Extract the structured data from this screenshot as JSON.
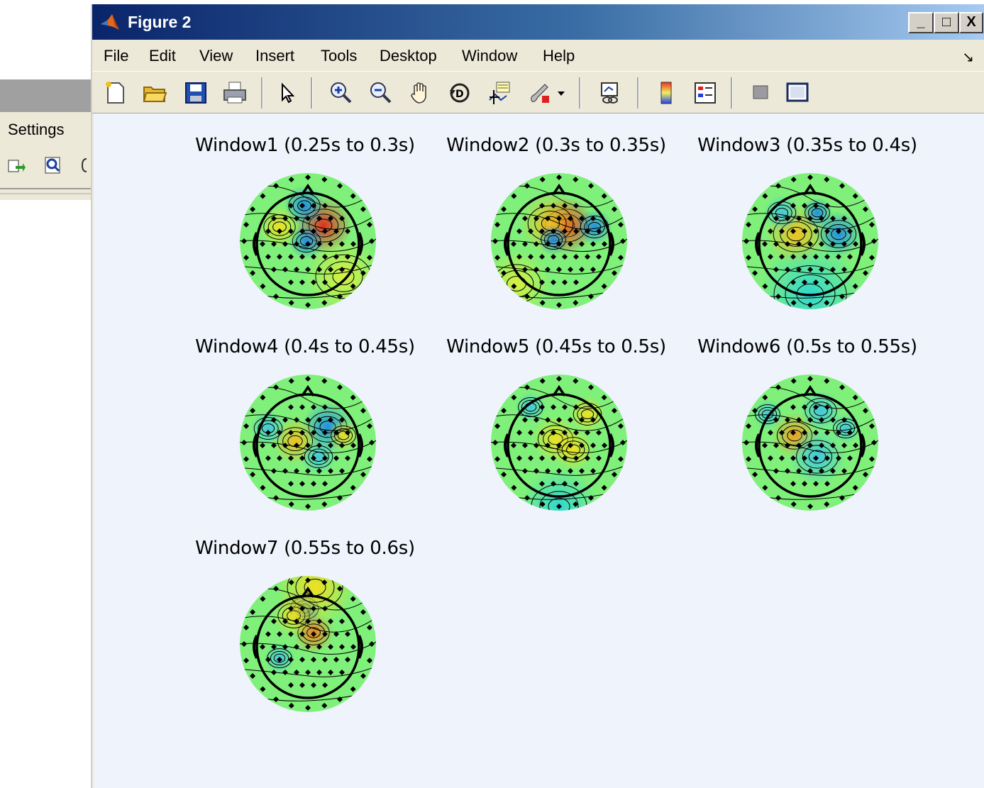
{
  "background_window": {
    "menu_label": "Settings"
  },
  "figure": {
    "title": "Figure 2",
    "window_buttons": {
      "minimize": "_",
      "maximize": "□",
      "close": "X"
    },
    "menu": [
      "File",
      "Edit",
      "View",
      "Insert",
      "Tools",
      "Desktop",
      "Window",
      "Help"
    ],
    "dock_arrow": "↘",
    "toolbar": [
      "new-figure-icon",
      "open-file-icon",
      "save-icon",
      "print-icon",
      "select-arrow-icon",
      "zoom-in-icon",
      "zoom-out-icon",
      "pan-hand-icon",
      "rotate-3d-icon",
      "data-cursor-icon",
      "brush-icon",
      "brush-dropdown-icon",
      "link-plot-icon",
      "colorbar-icon",
      "legend-icon",
      "hide-plot-tools-icon",
      "show-plot-tools-icon"
    ],
    "plots": [
      {
        "title": "Window1 (0.25s to 0.3s)"
      },
      {
        "title": "Window2 (0.3s to 0.35s)"
      },
      {
        "title": "Window3 (0.35s to 0.4s)"
      },
      {
        "title": "Window4 (0.4s to 0.45s)"
      },
      {
        "title": "Window5 (0.45s to 0.5s)"
      },
      {
        "title": "Window6 (0.5s to 0.55s)"
      },
      {
        "title": "Window7 (0.55s to 0.6s)"
      }
    ]
  },
  "colors": {
    "titlebar_start": "#0a246a",
    "titlebar_end": "#a6caf0",
    "canvas_bg": "#eef3fc",
    "topo_base": "#7ff07a",
    "topo_positive": "#e03020",
    "topo_negative": "#2090e0"
  }
}
